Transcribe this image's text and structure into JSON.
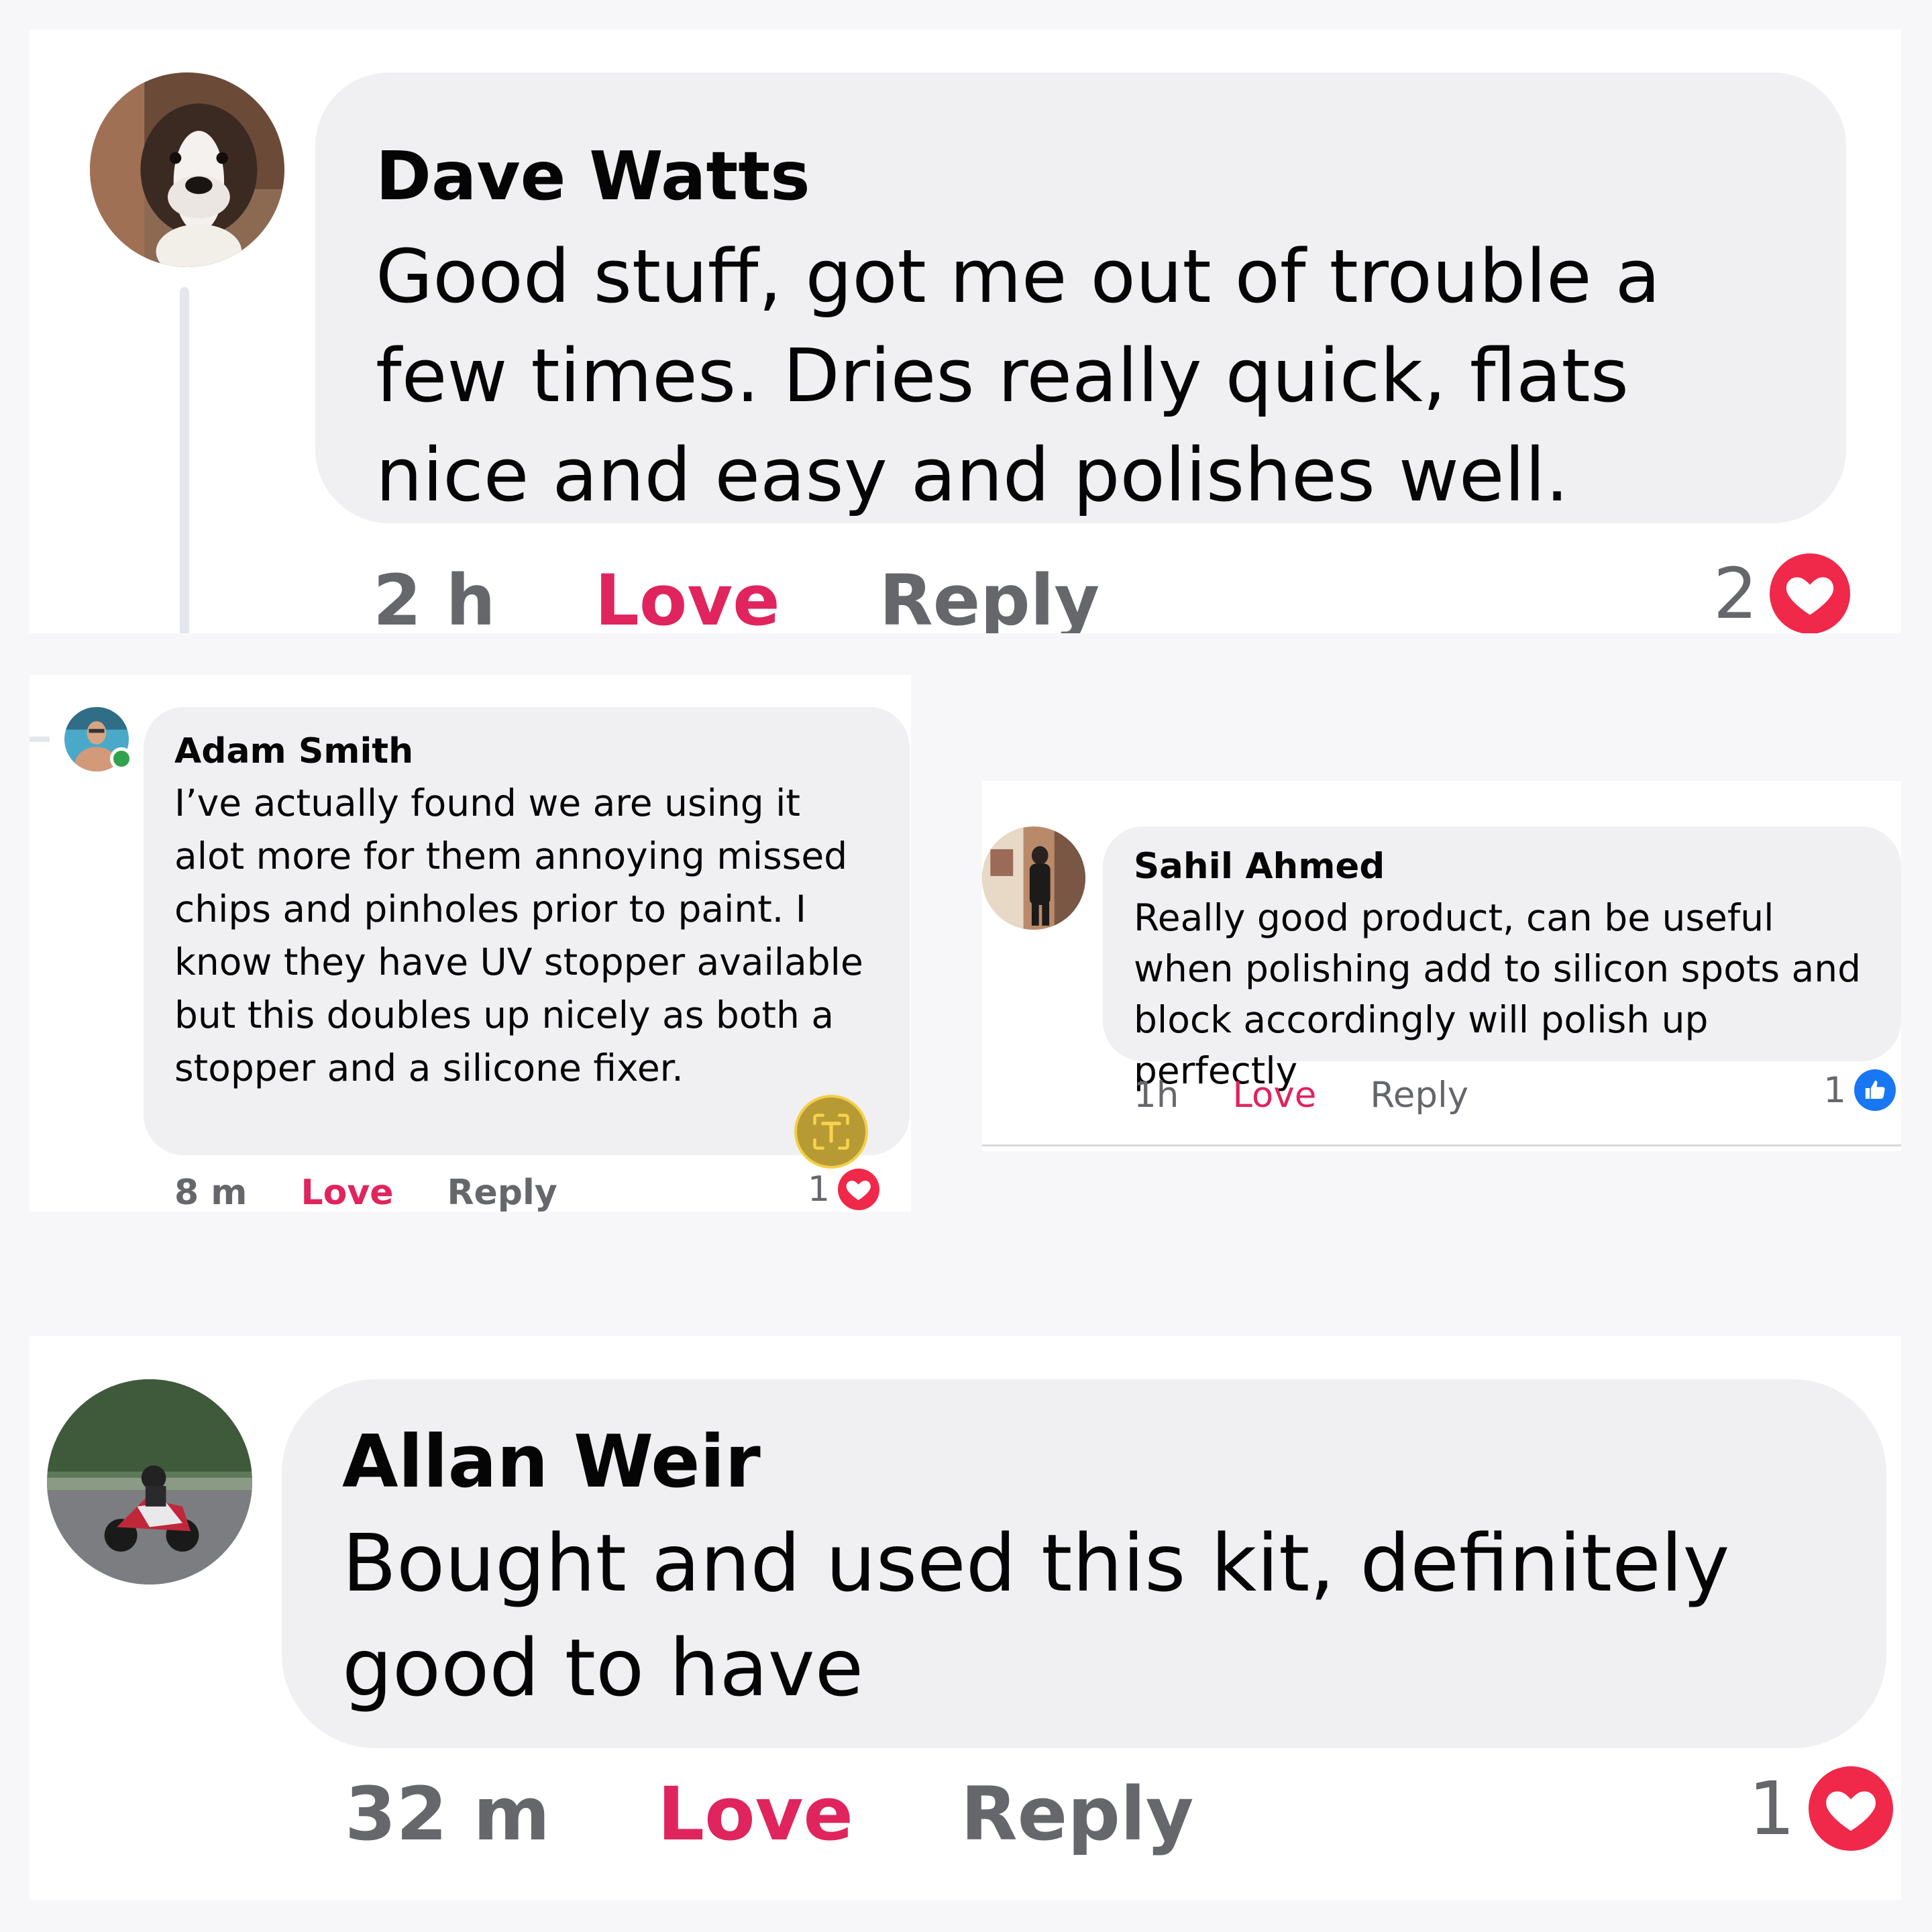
{
  "comments": [
    {
      "author": "Dave Watts",
      "text": "Good stuff, got me out of trouble a few times. Dries really quick, flats nice and easy and polishes well.",
      "time": "2 h",
      "love_label": "Love",
      "reply_label": "Reply",
      "reaction_count": "2",
      "reaction_icon": "heart-icon"
    },
    {
      "author": "Adam Smith",
      "text": "I’ve actually found we are using it alot more for them annoying missed chips and pinholes prior to paint. I know they have UV stopper available but this doubles up nicely as both a stopper and a silicone fixer.",
      "time": "8 m",
      "love_label": "Love",
      "reply_label": "Reply",
      "reaction_count": "1",
      "reaction_icon": "heart-icon"
    },
    {
      "author": "Sahil Ahmed",
      "text": "Really good product, can be useful when polishing add to silicon spots and block accordingly will polish up perfectly",
      "time": "1h",
      "love_label": "Love",
      "reply_label": "Reply",
      "reaction_count": "1",
      "reaction_icon": "like-icon"
    },
    {
      "author": "Allan Weir",
      "text": "Bought and used this kit, definitely good to have",
      "time": "32 m",
      "love_label": "Love",
      "reply_label": "Reply",
      "reaction_count": "1",
      "reaction_icon": "heart-icon"
    }
  ],
  "colors": {
    "love": "#e0245e",
    "heart": "#f02849",
    "like": "#1877f2",
    "bubble": "#f0f0f2",
    "meta": "#65676b"
  }
}
